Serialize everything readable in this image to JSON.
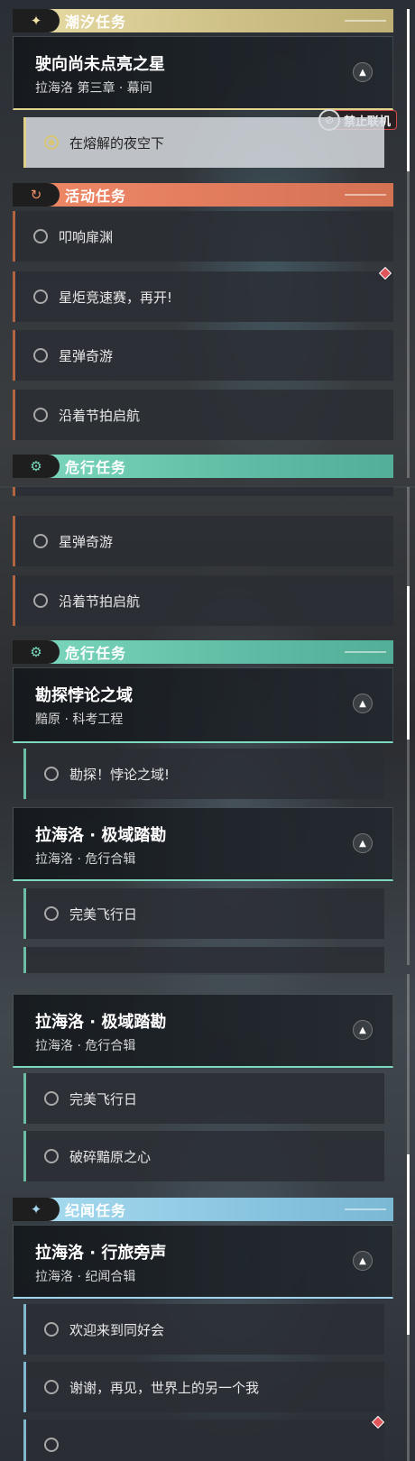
{
  "seg1": {
    "tide_header": "潮汐任务",
    "card_title": "驶向尚未点亮之星",
    "card_sub": "拉海洛 第三章 · 幕间",
    "sel_item": "在熔解的夜空下",
    "block_label": "禁止联机",
    "activity_header": "活动任务",
    "items": [
      "叩响扉渊",
      "星炬竞速赛，再开!",
      "星弹奇游",
      "沿着节拍启航"
    ],
    "danger_header_partial": "危行任务"
  },
  "seg2": {
    "items_top": [
      "星弹奇游",
      "沿着节拍启航"
    ],
    "danger_header": "危行任务",
    "card1_title": "勘探悖论之域",
    "card1_sub": "黯原 · 科考工程",
    "item1": "勘探！悖论之域!",
    "card2_title": "拉海洛 · 极域踏勘",
    "card2_sub": "拉海洛 · 危行合辑",
    "item2": "完美飞行日"
  },
  "seg3": {
    "card_title": "拉海洛 · 极域踏勘",
    "card_sub": "拉海洛 · 危行合辑",
    "items": [
      "完美飞行日",
      "破碎黯原之心"
    ],
    "lore_header": "纪闻任务",
    "card2_title": "拉海洛 · 行旅旁声",
    "card2_sub": "拉海洛 · 纪闻合辑",
    "items2": [
      "欢迎来到同好会",
      "谢谢，再见，世界上的另一个我"
    ]
  },
  "colors": {
    "tide": "#e0d188",
    "activity": "#e07a5c",
    "danger": "#60bca4",
    "lore": "#8ac6e0",
    "alert": "#d44a4a"
  }
}
